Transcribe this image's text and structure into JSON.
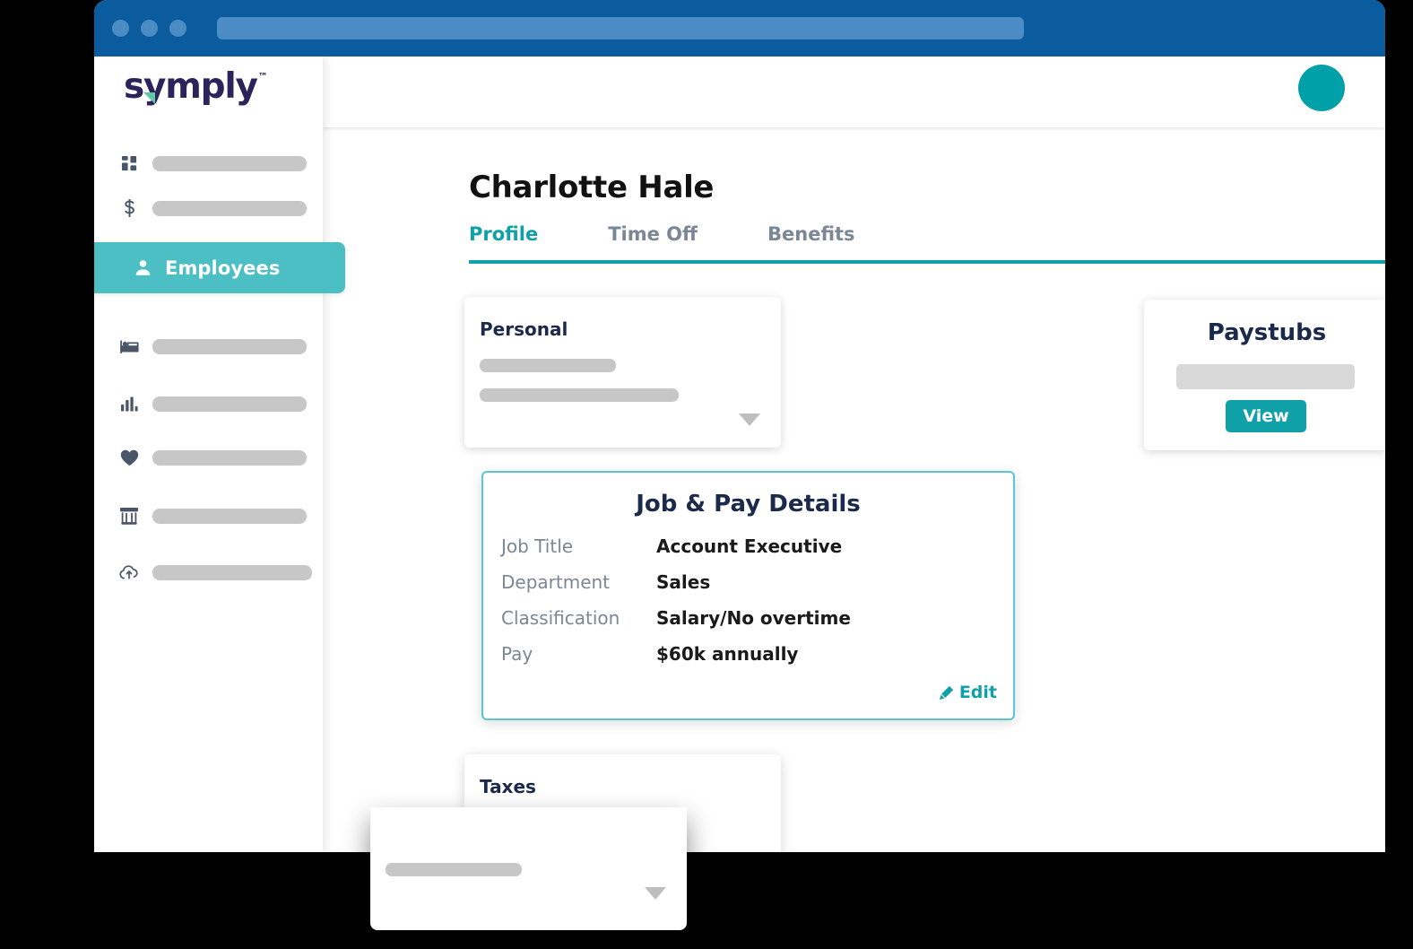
{
  "window": {
    "titlebar": {
      "dots": [
        "window-dot-1",
        "window-dot-2",
        "window-dot-3"
      ],
      "urlbar_value": ""
    }
  },
  "brand": {
    "logo_text": "symply",
    "logo_tm": "™",
    "logo_color": "#2B2359",
    "logo_accent_color": "#5FC9A5"
  },
  "sidebar": {
    "items": [
      {
        "icon": "grid-icon",
        "label": "",
        "placeholder_width": 172,
        "active": false
      },
      {
        "icon": "dollar-icon",
        "label": "",
        "placeholder_width": 172,
        "active": false
      },
      {
        "icon": "person-icon",
        "label": "Employees",
        "active": true
      },
      {
        "icon": "bed-icon",
        "label": "",
        "placeholder_width": 172,
        "active": false
      },
      {
        "icon": "bar-chart-icon",
        "label": "",
        "placeholder_width": 172,
        "active": false
      },
      {
        "icon": "heart-icon",
        "label": "",
        "placeholder_width": 172,
        "active": false
      },
      {
        "icon": "store-icon",
        "label": "",
        "placeholder_width": 172,
        "active": false
      },
      {
        "icon": "cloud-upload-icon",
        "label": "",
        "placeholder_width": 178,
        "active": false
      }
    ],
    "active_item_label": "Employees",
    "active_color": "#4BBFC3"
  },
  "topbar": {
    "avatar_color": "#00A0A8"
  },
  "main": {
    "page_title": "Charlotte Hale",
    "tabs": [
      {
        "label": "Profile",
        "active": true
      },
      {
        "label": "Time Off",
        "active": false
      },
      {
        "label": "Benefits",
        "active": false
      }
    ],
    "accent_color": "#0FA0A8"
  },
  "cards": {
    "personal": {
      "title": "Personal",
      "placeholder_bars": [
        152,
        222
      ],
      "caret_icon": "chevron-down-icon"
    },
    "job_pay": {
      "title": "Job & Pay Details",
      "rows": [
        {
          "label": "Job Title",
          "value": "Account Executive"
        },
        {
          "label": "Department",
          "value": "Sales"
        },
        {
          "label": "Classification",
          "value": "Salary/No overtime"
        },
        {
          "label": "Pay",
          "value": "$60k annually"
        }
      ],
      "edit_label": "Edit",
      "edit_icon": "pencil-icon",
      "border_color": "#5BC5D0"
    },
    "taxes": {
      "title": "Taxes",
      "placeholder_bars": [
        152,
        152,
        152
      ],
      "caret_icon": "chevron-down-icon"
    },
    "paystubs": {
      "title": "Paystubs",
      "placeholder_value": "",
      "view_label": "View",
      "button_color": "#0FA0A8"
    }
  }
}
